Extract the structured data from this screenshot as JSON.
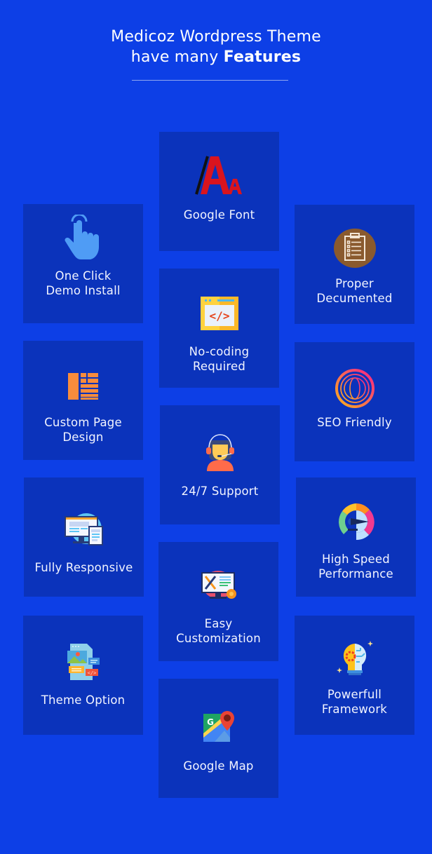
{
  "header": {
    "title_line1": "Medicoz Wordpress Theme",
    "title_line2_prefix": "have many ",
    "title_line2_bold": "Features"
  },
  "colors": {
    "background": "#0d3fe6",
    "card": "#0b33bb",
    "divider": "#8fa6f0",
    "text": "#ffffff"
  },
  "features": [
    {
      "id": "google-font",
      "icon": "font-icon",
      "lines": [
        "Google Font"
      ]
    },
    {
      "id": "one-click-demo",
      "icon": "pointer-hand-icon",
      "lines": [
        "One Click",
        "Demo Install"
      ]
    },
    {
      "id": "proper-documented",
      "icon": "clipboard-icon",
      "lines": [
        "Proper",
        "Decumented"
      ]
    },
    {
      "id": "no-coding",
      "icon": "code-window-icon",
      "lines": [
        "No-coding",
        "Required"
      ]
    },
    {
      "id": "custom-page-design",
      "icon": "layout-icon",
      "lines": [
        "Custom Page",
        "Design"
      ]
    },
    {
      "id": "seo-friendly",
      "icon": "globe-target-icon",
      "lines": [
        "SEO Friendly"
      ]
    },
    {
      "id": "support",
      "icon": "support-agent-icon",
      "lines": [
        "24/7 Support"
      ]
    },
    {
      "id": "fully-responsive",
      "icon": "devices-icon",
      "lines": [
        "Fully Responsive"
      ]
    },
    {
      "id": "high-speed",
      "icon": "speedometer-icon",
      "lines": [
        "High Speed",
        "Performance"
      ]
    },
    {
      "id": "easy-customization",
      "icon": "tools-monitor-icon",
      "lines": [
        "Easy",
        "Customization"
      ]
    },
    {
      "id": "theme-option",
      "icon": "theme-files-icon",
      "lines": [
        "Theme Option"
      ]
    },
    {
      "id": "powerfull-framework",
      "icon": "lightbulb-gear-icon",
      "lines": [
        "Powerfull",
        "Framework"
      ]
    },
    {
      "id": "google-map",
      "icon": "map-pin-icon",
      "lines": [
        "Google Map"
      ]
    }
  ]
}
